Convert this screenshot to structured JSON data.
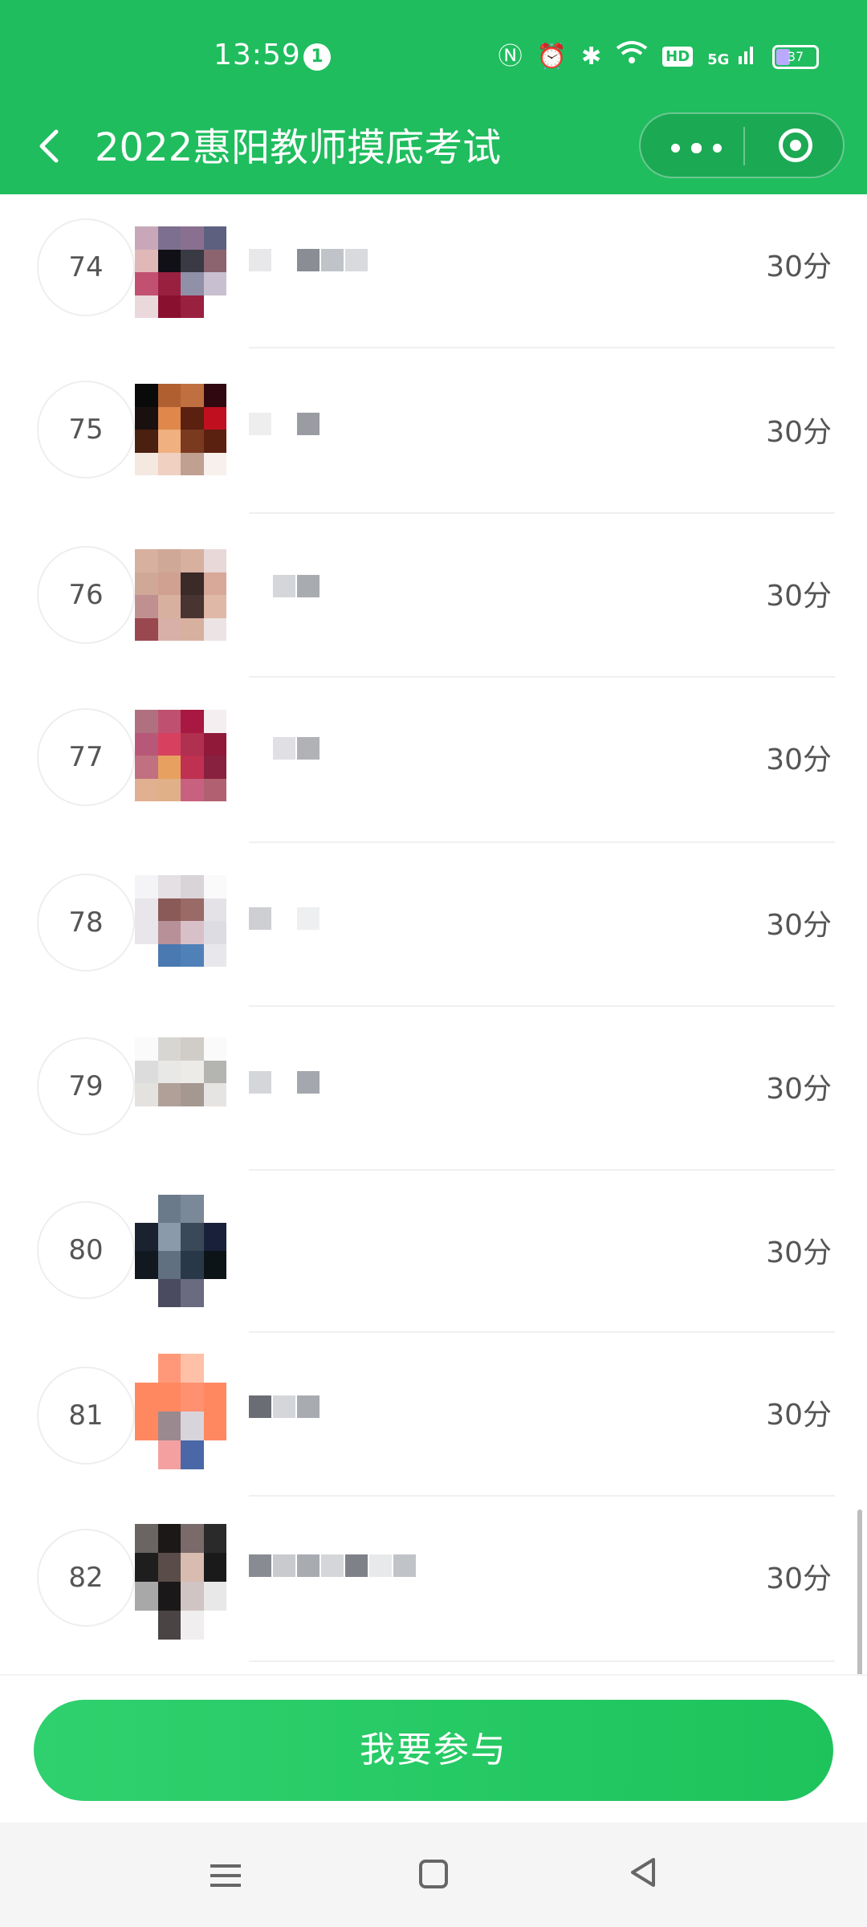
{
  "status_bar": {
    "time": "13:59",
    "notification_count": "1",
    "network": "5G",
    "hd_badge": "HD",
    "battery_percent": "37",
    "icons": [
      "nfc-icon",
      "alarm-icon",
      "bluetooth-icon",
      "wifi-icon",
      "signal-icon",
      "battery-icon"
    ]
  },
  "header": {
    "title": "2022惠阳教师摸底考试",
    "back_icon": "chevron-left-icon",
    "more_icon": "more-dots-icon",
    "close_icon": "target-circle-icon"
  },
  "leaderboard": [
    {
      "rank": "74",
      "score": "30分"
    },
    {
      "rank": "75",
      "score": "30分"
    },
    {
      "rank": "76",
      "score": "30分"
    },
    {
      "rank": "77",
      "score": "30分"
    },
    {
      "rank": "78",
      "score": "30分"
    },
    {
      "rank": "79",
      "score": "30分"
    },
    {
      "rank": "80",
      "score": "30分"
    },
    {
      "rank": "81",
      "score": "30分"
    },
    {
      "rank": "82",
      "score": "30分"
    }
  ],
  "bottom": {
    "join_label": "我要参与"
  },
  "colors": {
    "brand_green": "#1fbd5e",
    "button_green": "#2fd16e"
  }
}
